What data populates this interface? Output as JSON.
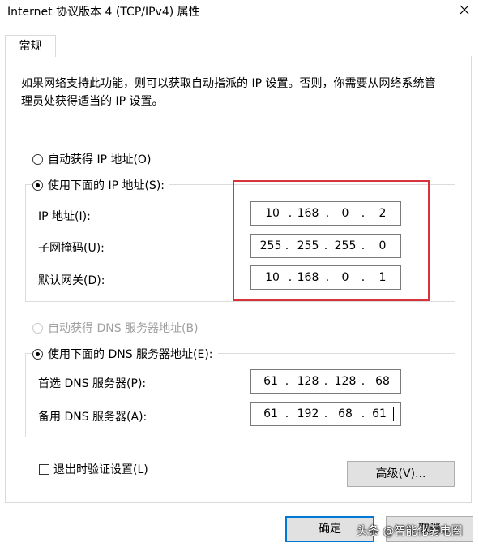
{
  "window": {
    "title": "Internet 协议版本 4 (TCP/IPv4) 属性",
    "close_icon": "close-icon"
  },
  "tabs": [
    {
      "label": "常规",
      "selected": true
    }
  ],
  "description": "如果网络支持此功能，则可以获取自动指派的 IP 设置。否则，你需要从网络系统管理员处获得适当的 IP 设置。",
  "ip": {
    "auto_label": "自动获得 IP 地址(O)",
    "manual_label": "使用下面的 IP 地址(S):",
    "selected": "manual",
    "fields": [
      {
        "label": "IP 地址(I):",
        "octets": [
          "10",
          "168",
          "0",
          "2"
        ]
      },
      {
        "label": "子网掩码(U):",
        "octets": [
          "255",
          "255",
          "255",
          "0"
        ]
      },
      {
        "label": "默认网关(D):",
        "octets": [
          "10",
          "168",
          "0",
          "1"
        ]
      }
    ]
  },
  "dns": {
    "auto_label": "自动获得 DNS 服务器地址(B)",
    "manual_label": "使用下面的 DNS 服务器地址(E):",
    "selected": "manual",
    "fields": [
      {
        "label": "首选 DNS 服务器(P):",
        "octets": [
          "61",
          "128",
          "128",
          "68"
        ]
      },
      {
        "label": "备用 DNS 服务器(A):",
        "octets": [
          "61",
          "192",
          "68",
          "61"
        ]
      }
    ]
  },
  "validate": {
    "label": "退出时验证设置(L)",
    "checked": false
  },
  "buttons": {
    "advanced": "高级(V)...",
    "ok": "确定",
    "cancel": "取消"
  },
  "watermark": "头条 @智能化弱电圈",
  "highlight_color": "#d6333a"
}
